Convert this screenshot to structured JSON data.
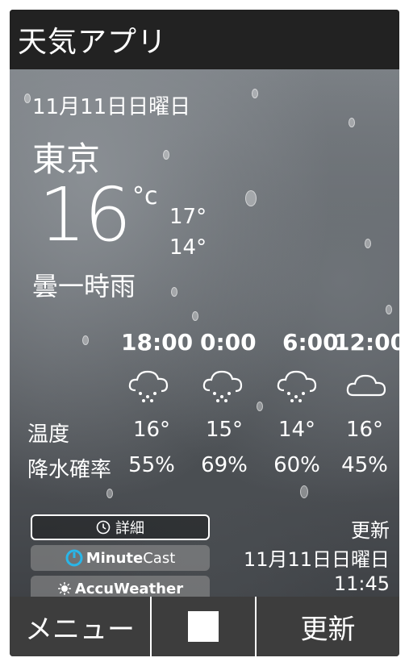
{
  "app": {
    "title": "天気アプリ"
  },
  "current": {
    "date": "11月11日日曜日",
    "city": "東京",
    "temperature": "16",
    "unit": "°c",
    "high": "17°",
    "low": "14°",
    "condition": "曇一時雨"
  },
  "forecast": {
    "temp_label": "温度",
    "precip_label": "降水確率",
    "hours": [
      {
        "time": "18:00",
        "icon": "cloud-rain-icon",
        "temp": "16°",
        "precip": "55%"
      },
      {
        "time": "0:00",
        "icon": "cloud-rain-icon",
        "temp": "15°",
        "precip": "69%"
      },
      {
        "time": "6:00",
        "icon": "cloud-rain-icon",
        "temp": "14°",
        "precip": "60%"
      },
      {
        "time": "12:00",
        "icon": "cloud-icon",
        "temp": "16°",
        "precip": "45%"
      }
    ]
  },
  "buttons": {
    "detail": "詳細",
    "minutecast_a": "Minute",
    "minutecast_b": "Cast",
    "accuweather": "AccuWeather"
  },
  "updated": {
    "label": "更新",
    "date": "11月11日日曜日",
    "time": "11:45"
  },
  "bottombar": {
    "menu": "メニュー",
    "refresh": "更新"
  }
}
